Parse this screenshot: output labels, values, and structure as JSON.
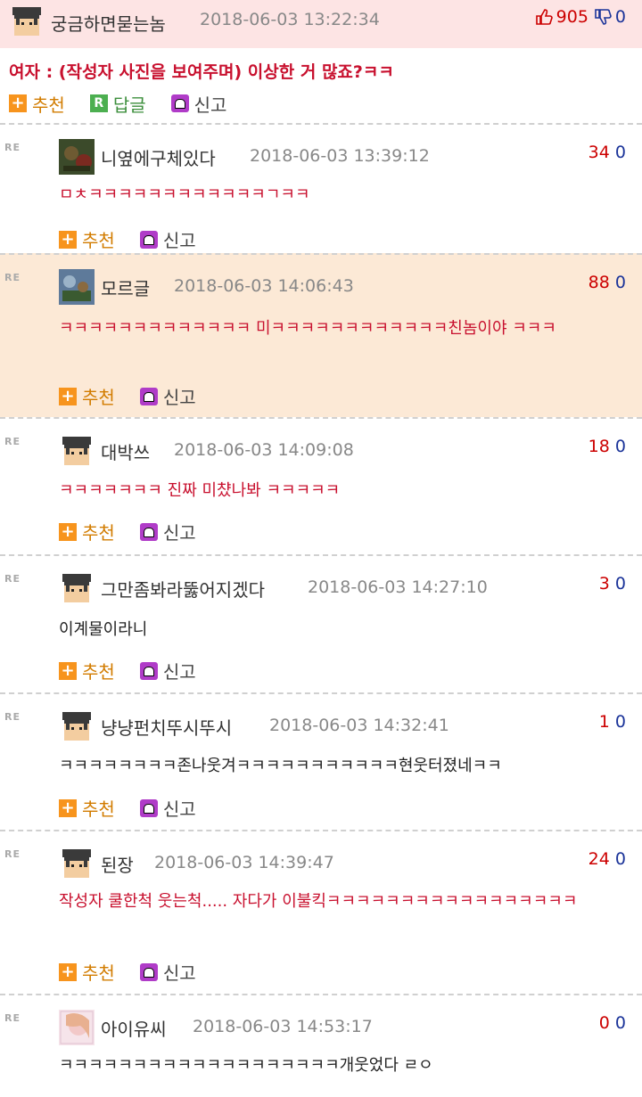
{
  "post": {
    "author": "궁금하면묻는놈",
    "time": "2018-06-03 13:22:34",
    "up": "905",
    "down": "0",
    "title": "여자 : (작성자 사진을 보여주며) 이상한 거 많죠?ㅋㅋ",
    "actions": {
      "recommend": "추천",
      "reply": "답글",
      "report": "신고"
    }
  },
  "re_label": "RE",
  "comments": [
    {
      "author": "니옆에구체있다",
      "time": "2018-06-03 13:39:12",
      "up": "34",
      "down": "0",
      "text": "ㅁㅊㅋㅋㅋㅋㅋㅋㅋㅋㅋㅋㅋㅋㄱㅋㅋ",
      "recommend": "추천",
      "report": "신고"
    },
    {
      "author": "모르글",
      "time": "2018-06-03 14:06:43",
      "up": "88",
      "down": "0",
      "text": "ㅋㅋㅋㅋㅋㅋㅋㅋㅋㅋㅋㅋㅋ 미ㅋㅋㅋㅋㅋㅋㅋㅋㅋㅋㅋㅋ친놈이야 ㅋㅋㅋ",
      "recommend": "추천",
      "report": "신고"
    },
    {
      "author": "대박쓰",
      "time": "2018-06-03 14:09:08",
      "up": "18",
      "down": "0",
      "text": "ㅋㅋㅋㅋㅋㅋㅋ 진짜 미챴나봐 ㅋㅋㅋㅋㅋ",
      "recommend": "추천",
      "report": "신고"
    },
    {
      "author": "그만좀봐라뚫어지겠다",
      "time": "2018-06-03 14:27:10",
      "up": "3",
      "down": "0",
      "text": "이계물이라니",
      "recommend": "추천",
      "report": "신고"
    },
    {
      "author": "냥냥펀치뚜시뚜시",
      "time": "2018-06-03 14:32:41",
      "up": "1",
      "down": "0",
      "text": "ㅋㅋㅋㅋㅋㅋㅋㅋ존나웃겨ㅋㅋㅋㅋㅋㅋㅋㅋㅋㅋㅋ현웃터졌네ㅋㅋ",
      "recommend": "추천",
      "report": "신고"
    },
    {
      "author": "된장",
      "time": "2018-06-03 14:39:47",
      "up": "24",
      "down": "0",
      "text": "작성자 쿨한척 웃는척..... 자다가 이불킥ㅋㅋㅋㅋㅋㅋㅋㅋㅋㅋㅋㅋㅋㅋㅋㅋㅋ",
      "recommend": "추천",
      "report": "신고"
    },
    {
      "author": "아이유씨",
      "time": "2018-06-03 14:53:17",
      "up": "0",
      "down": "0",
      "text": "ㅋㅋㅋㅋㅋㅋㅋㅋㅋㅋㅋㅋㅋㅋㅋㅋㅋㅋㅋ개웃었다 ㄹㅇ",
      "recommend": "추천",
      "report": "신고"
    }
  ]
}
